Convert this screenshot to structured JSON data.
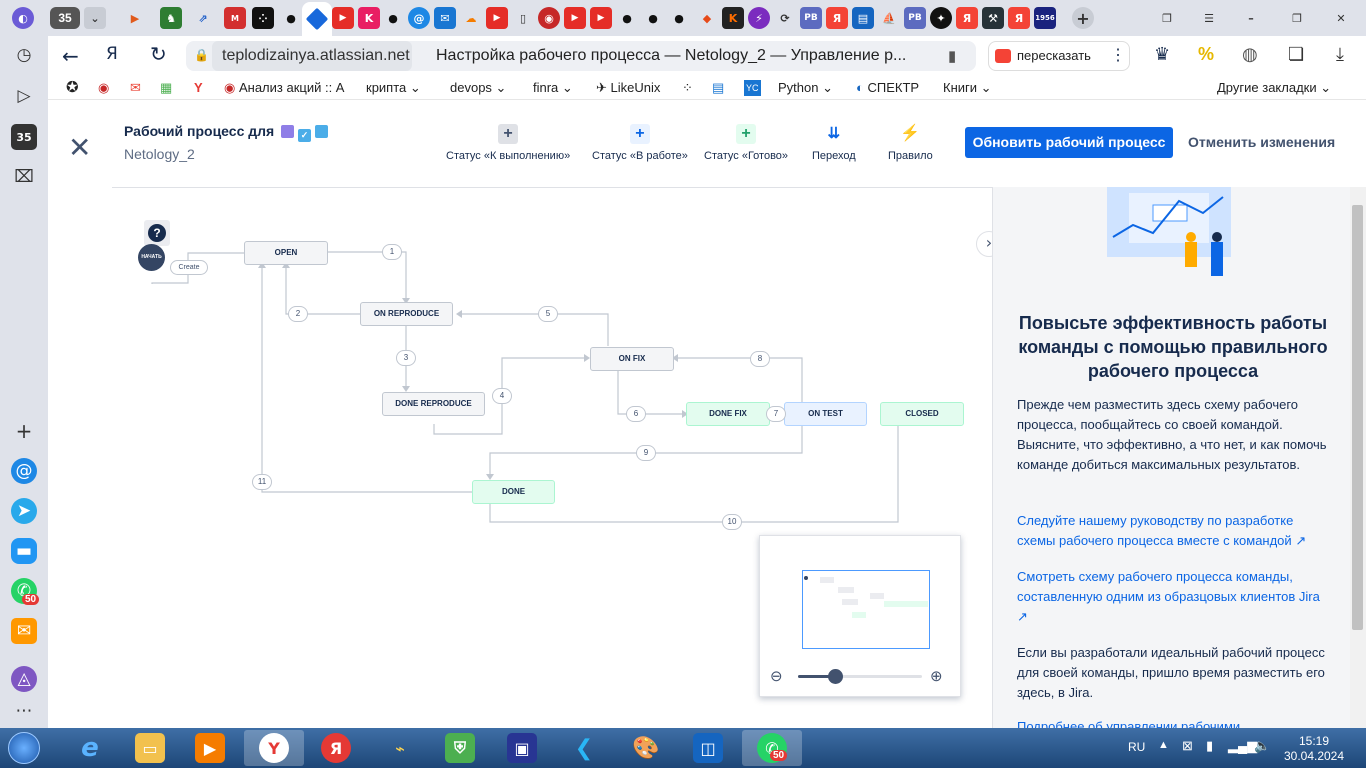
{
  "browser": {
    "tab_count": "35",
    "url_host": "teplodizainya.atlassian.net",
    "page_title": "Настройка рабочего процесса — Netology_2 — Управление р...",
    "retell_label": "пересказать",
    "bookmarks": [
      {
        "label": "Анализ акций :: А"
      },
      {
        "label": "крипта"
      },
      {
        "label": "devops"
      },
      {
        "label": "finra"
      },
      {
        "label": "LikeUnix"
      },
      {
        "label": "Python"
      },
      {
        "label": "СПЕКТР"
      },
      {
        "label": "Книги"
      },
      {
        "label": "Другие закладки"
      }
    ],
    "rail_badge_count": "35",
    "whatsapp_badge": "50"
  },
  "jira": {
    "title": "Рабочий процесс для",
    "project": "Netology_2",
    "tools": [
      {
        "label": "Статус «К выполнению»",
        "icon": "plus-icon"
      },
      {
        "label": "Статус «В работе»",
        "icon": "plus-icon"
      },
      {
        "label": "Статус «Готово»",
        "icon": "plus-icon"
      },
      {
        "label": "Переход",
        "icon": "transition-icon"
      },
      {
        "label": "Правило",
        "icon": "lightning-icon"
      }
    ],
    "update_button": "Обновить рабочий процесс",
    "cancel_button": "Отменить изменения",
    "colors": {
      "primary": "#0c66e4",
      "todo": "#f4f5f7",
      "inprogress": "#e9f2ff",
      "done": "#e3fcef"
    }
  },
  "workflow": {
    "start_label": "НАЧАТЬ",
    "create_label": "Create",
    "statuses": [
      {
        "name": "OPEN",
        "category": "todo"
      },
      {
        "name": "ON REPRODUCE",
        "category": "todo"
      },
      {
        "name": "DONE REPRODUCE",
        "category": "todo"
      },
      {
        "name": "ON FIX",
        "category": "todo"
      },
      {
        "name": "DONE FIX",
        "category": "done"
      },
      {
        "name": "ON TEST",
        "category": "inprogress"
      },
      {
        "name": "CLOSED",
        "category": "done"
      },
      {
        "name": "DONE",
        "category": "done"
      }
    ],
    "transitions": [
      "1",
      "2",
      "3",
      "4",
      "5",
      "6",
      "7",
      "8",
      "9",
      "10",
      "11"
    ]
  },
  "panel": {
    "heading": "Повысьте эффективность работы команды с помощью правильного рабочего процесса",
    "intro": "Прежде чем разместить здесь схему рабочего процесса, пообщайтесь со своей командой. Выясните, что эффективно, а что нет, и как помочь команде добиться максимальных результатов.",
    "link1": "Следуйте нашему руководству по разработке схемы рабочего процесса вместе с командой",
    "link2": "Смотреть схему рабочего процесса команды, составленную одним из образцовых клиентов Jira",
    "outro": "Если вы разработали идеальный рабочий процесс для своей команды, пришло время разместить его здесь, в Jira.",
    "cut_link": "Подробнее об управлении рабочими"
  },
  "minimap": {
    "zoom": 0.3
  },
  "taskbar": {
    "lang": "RU",
    "time": "15:19",
    "date": "30.04.2024",
    "whatsapp_badge": "50"
  }
}
